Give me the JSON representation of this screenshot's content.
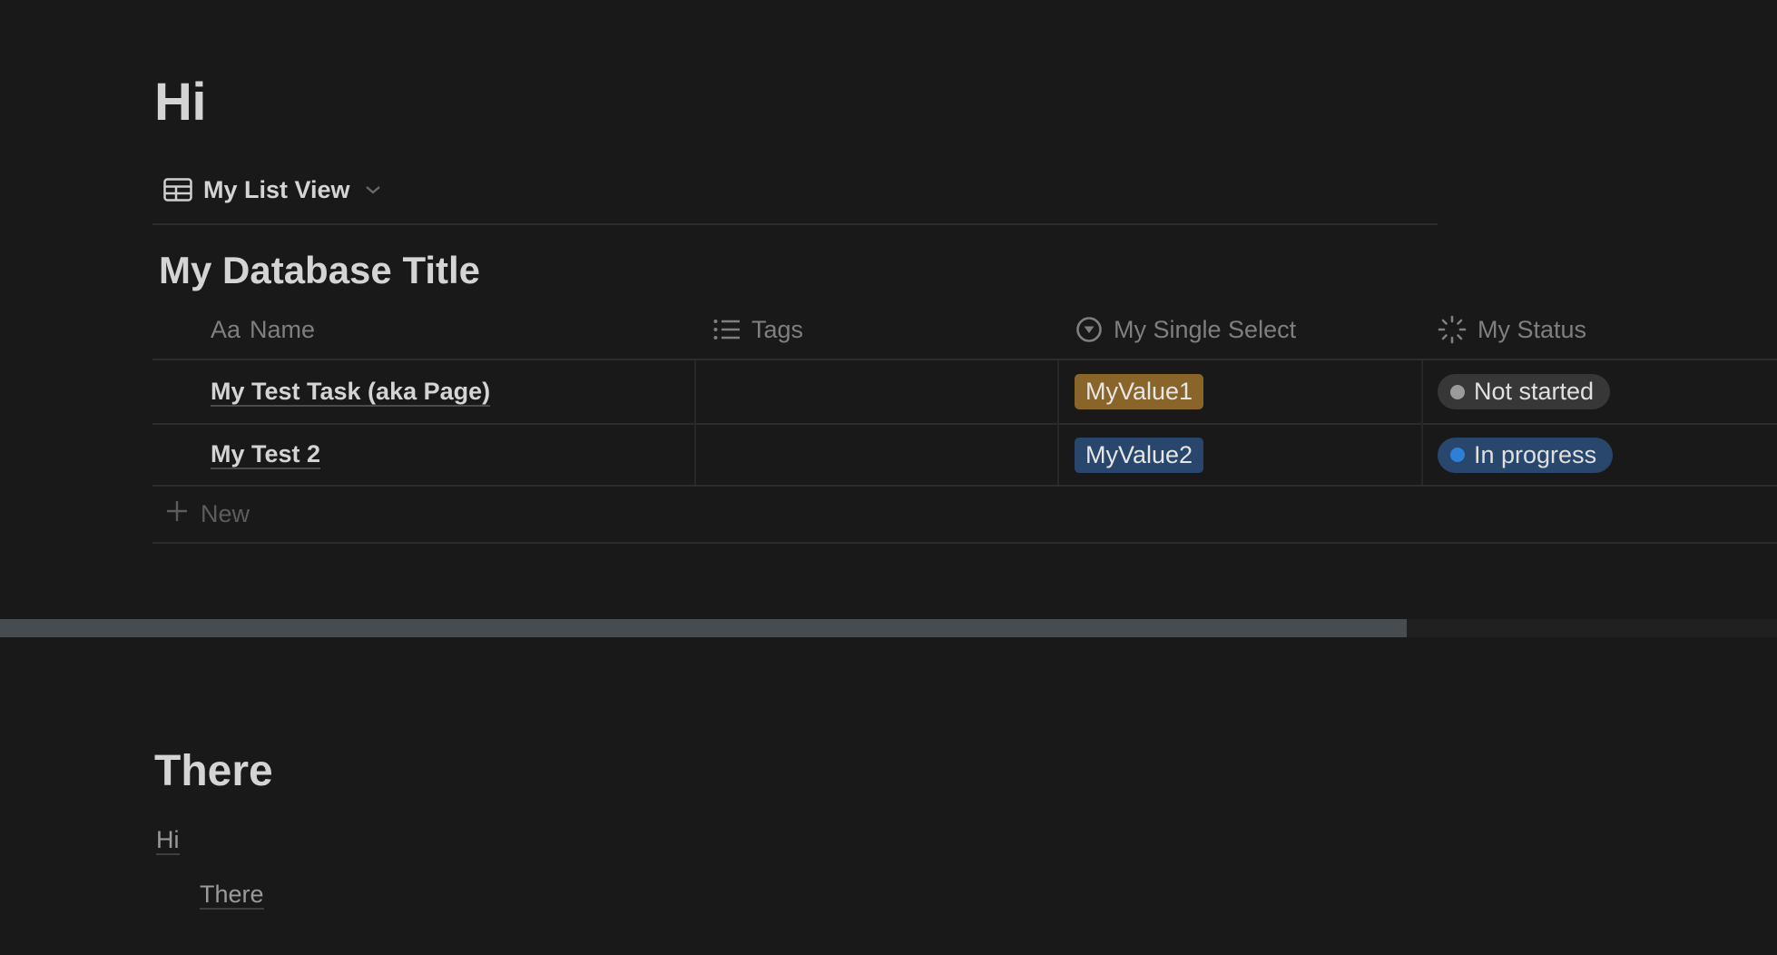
{
  "page": {
    "title": "Hi"
  },
  "view_tab": {
    "icon": "table-icon",
    "label": "My List View",
    "dropdown_icon": "chevron-down-icon"
  },
  "database": {
    "title": "My Database Title",
    "columns": [
      {
        "label": "Name",
        "icon": "text-aa-icon",
        "icon_text": "Aa"
      },
      {
        "label": "Tags",
        "icon": "list-icon"
      },
      {
        "label": "My Single Select",
        "icon": "select-circle-icon"
      },
      {
        "label": "My Status",
        "icon": "status-loader-icon"
      }
    ],
    "rows": [
      {
        "name": "My Test Task (aka Page)",
        "tags": "",
        "single_select": {
          "label": "MyValue1",
          "color": "#8a6529"
        },
        "status": {
          "label": "Not started",
          "bg": "#373737",
          "dot": "#9b9b9b"
        }
      },
      {
        "name": "My Test 2",
        "tags": "",
        "single_select": {
          "label": "MyValue2",
          "color": "#29466c"
        },
        "status": {
          "label": "In progress",
          "bg": "#29466c",
          "dot": "#2d7fd8"
        }
      }
    ],
    "new_label": "New"
  },
  "scrollbar": {
    "horizontal_position_fraction": 0,
    "visible_fraction": 0.79
  },
  "section": {
    "heading": "There",
    "links": [
      {
        "label": "Hi",
        "indent": 0
      },
      {
        "label": "There",
        "indent": 1
      }
    ]
  }
}
